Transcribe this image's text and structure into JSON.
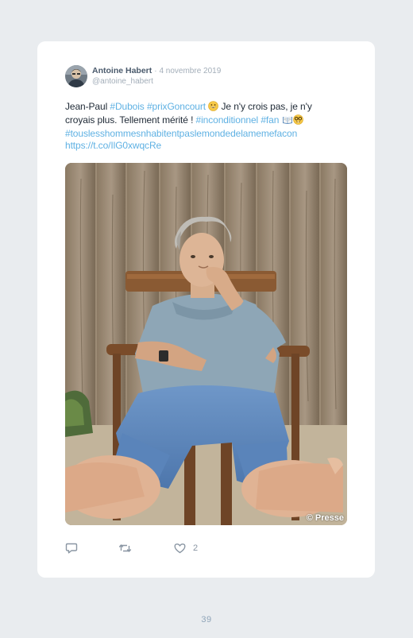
{
  "tweet": {
    "display_name": "Antoine Habert",
    "separator": "·",
    "date": "4 novembre 2019",
    "handle": "@antoine_habert",
    "text": {
      "l1_a": "Jean-Paul ",
      "l1_tag1": "#Dubois",
      "l1_space1": " ",
      "l1_tag2": "#prixGoncourt",
      "l1_b": " Je n'y crois pas, je n'y",
      "l2_a": "croyais plus. Tellement mérité ! ",
      "l2_tag1": "#inconditionnel",
      "l2_space": " ",
      "l2_tag2": "#fan",
      "l3_tag": "#touslesshommesnhabitentpaslemondedelamemefacon",
      "l4_link": "https://t.co/IlG0xwqcRe"
    },
    "emojis": [
      "grinning-face",
      "open-book",
      "nerd-face"
    ],
    "media": {
      "watermark": "© Presse"
    },
    "actions": {
      "like_count": "2"
    }
  },
  "page": {
    "number": "39"
  },
  "colors": {
    "background": "#e9ecef",
    "card": "#ffffff",
    "link": "#5fb1e3",
    "muted": "#a3aeb9",
    "name": "#4a5a6c",
    "page_number": "#8fa4b8"
  }
}
